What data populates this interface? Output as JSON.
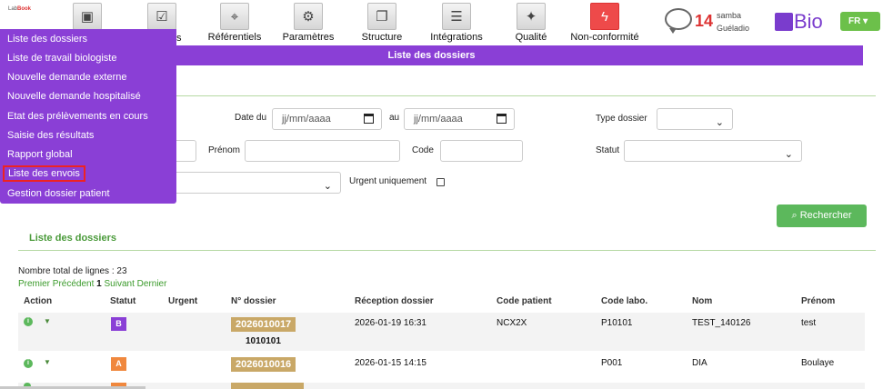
{
  "brand": {
    "logo_left": "Lab",
    "logo_right": "Book",
    "bio_label": "Bio"
  },
  "nav": [
    {
      "label": "",
      "icon": "inbox-icon"
    },
    {
      "label": "s",
      "icon": "clipboard-check-icon"
    },
    {
      "label": "Référentiels",
      "icon": "map-pin-icon"
    },
    {
      "label": "Paramètres",
      "icon": "gears-icon"
    },
    {
      "label": "Structure",
      "icon": "documents-icon"
    },
    {
      "label": "Intégrations",
      "icon": "sliders-icon"
    },
    {
      "label": "Qualité",
      "icon": "satellite-icon"
    },
    {
      "label": "Non-conformité",
      "icon": "lightning-icon"
    }
  ],
  "user": {
    "notifications": "14",
    "first_name": "samba",
    "last_name": "Guéladio"
  },
  "lang": "FR",
  "menu": {
    "items": [
      "Liste des dossiers",
      "Liste de travail biologiste",
      "Nouvelle demande externe",
      "Nouvelle demande hospitalisé",
      "Etat des prélèvements en cours",
      "Saisie des résultats",
      "Rapport global",
      "Liste des envois",
      "Gestion dossier patient"
    ],
    "highlighted": "Liste des envois"
  },
  "page_title": "Liste des dossiers",
  "filters": {
    "date_du_label": "Date du",
    "date_au_label": "au",
    "date_placeholder": "jj/mm/aaaa",
    "type_dossier_label": "Type dossier",
    "prenom_label": "Prénom",
    "code_label": "Code",
    "statut_label": "Statut",
    "urgent_label": "Urgent uniquement",
    "search_label": "Rechercher"
  },
  "list": {
    "title": "Liste des dossiers",
    "total_text": "Nombre total de lignes : 23",
    "pager": {
      "first": "Premier",
      "prev": "Précédent",
      "current": "1",
      "next": "Suivant",
      "last": "Dernier"
    },
    "columns": [
      "Action",
      "Statut",
      "Urgent",
      "N° dossier",
      "Réception dossier",
      "Code patient",
      "Code labo.",
      "Nom",
      "Prénom"
    ],
    "rows": [
      {
        "statut": "B",
        "statut_color": "#8a3fd6",
        "dossier": "2026010017",
        "sub": "1010101",
        "reception": "2026-01-19 16:31",
        "code_patient": "NCX2X",
        "code_labo": "P10101",
        "nom": "TEST_140126",
        "prenom": "test"
      },
      {
        "statut": "A",
        "statut_color": "#f0883e",
        "dossier": "2026010016",
        "sub": "",
        "reception": "2026-01-15 14:15",
        "code_patient": "",
        "code_labo": "P001",
        "nom": "DIA",
        "prenom": "Boulaye"
      }
    ]
  },
  "colors": {
    "purple": "#8a3fd6",
    "green": "#5cb85c",
    "dossier_badge": "#c9a867"
  }
}
